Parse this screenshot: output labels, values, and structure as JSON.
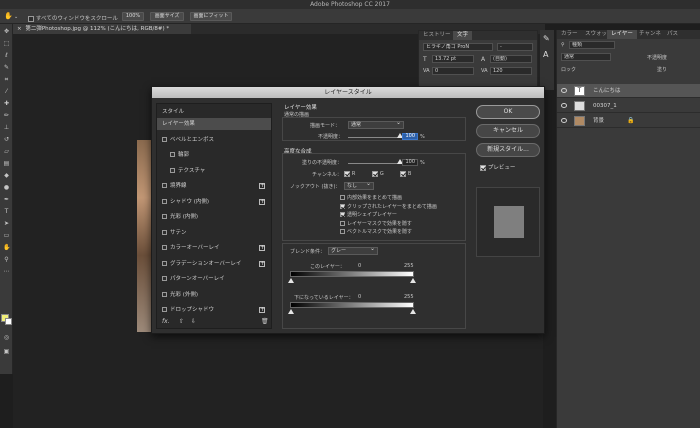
{
  "app_title": "Adobe Photoshop CC 2017",
  "options_bar": {
    "scroll_all_label": "すべてのウィンドウをスクロール",
    "zoom_100": "100%",
    "fit_screen": "画面サイズ",
    "fill_screen": "画面にフィット"
  },
  "document_tab": "第二弾Photoshop.jpg @ 112% (こんにちは, RGB/8#) *",
  "char_panel": {
    "tabs": [
      "ヒストリー",
      "文字"
    ],
    "active_tab": "文字",
    "font_family": "ヒラギノ角ゴ ProN",
    "font_style": "-",
    "font_size": "13.72 pt",
    "leading": "(自動)",
    "kerning": "0",
    "tracking": "120"
  },
  "layers_panel": {
    "tabs": [
      "カラー",
      "スウォッ",
      "レイヤー",
      "チャンネ",
      "パス"
    ],
    "active_tab": "レイヤー",
    "filter_kind": "種類",
    "blend_mode": "通常",
    "opacity_label": "不透明度",
    "lock_label": "ロック",
    "fill_label": "塗り",
    "layers": [
      {
        "name": "こんにちは",
        "type": "text",
        "selected": true
      },
      {
        "name": "00307_1",
        "type": "image",
        "selected": false
      },
      {
        "name": "背景",
        "type": "background",
        "selected": false
      }
    ]
  },
  "dialog": {
    "title": "レイヤースタイル",
    "styles_header": "スタイル",
    "styles": [
      {
        "label": "レイヤー効果",
        "selected": true,
        "checkbox": false,
        "plus": false,
        "indent": false
      },
      {
        "label": "ベベルとエンボス",
        "checkbox": true,
        "plus": false,
        "indent": false
      },
      {
        "label": "輪郭",
        "checkbox": true,
        "plus": false,
        "indent": true
      },
      {
        "label": "テクスチャ",
        "checkbox": true,
        "plus": false,
        "indent": true
      },
      {
        "label": "境界線",
        "checkbox": true,
        "plus": true,
        "indent": false
      },
      {
        "label": "シャドウ (内側)",
        "checkbox": true,
        "plus": true,
        "indent": false
      },
      {
        "label": "光彩 (内側)",
        "checkbox": true,
        "plus": false,
        "indent": false
      },
      {
        "label": "サテン",
        "checkbox": true,
        "plus": false,
        "indent": false
      },
      {
        "label": "カラーオーバーレイ",
        "checkbox": true,
        "plus": true,
        "indent": false
      },
      {
        "label": "グラデーションオーバーレイ",
        "checkbox": true,
        "plus": true,
        "indent": false
      },
      {
        "label": "パターンオーバーレイ",
        "checkbox": true,
        "plus": false,
        "indent": false
      },
      {
        "label": "光彩 (外側)",
        "checkbox": true,
        "plus": false,
        "indent": false
      },
      {
        "label": "ドロップシャドウ",
        "checkbox": true,
        "plus": true,
        "indent": false
      }
    ],
    "fx_label": "fx.",
    "general": {
      "section": "レイヤー効果",
      "subsection": "通常の描画",
      "blend_mode_label": "描画モード：",
      "blend_mode_value": "通常",
      "opacity_label": "不透明度：",
      "opacity_value": "100",
      "opacity_unit": "%",
      "opacity_level": 1.0
    },
    "advanced": {
      "section": "高度な合成",
      "fill_opacity_label": "塗りの不透明度：",
      "fill_opacity_value": "100",
      "fill_opacity_unit": "%",
      "fill_opacity_level": 1.0,
      "channels_label": "チャンネル：",
      "channels": [
        "R",
        "G",
        "B"
      ],
      "knockout_label": "ノックアウト (抜き)：",
      "knockout_value": "なし",
      "options": [
        {
          "label": "内部効果をまとめて描画",
          "checked": false
        },
        {
          "label": "クリップされたレイヤーをまとめて描画",
          "checked": true
        },
        {
          "label": "透明シェイプレイヤー",
          "checked": true
        },
        {
          "label": "レイヤーマスクで効果を隠す",
          "checked": false
        },
        {
          "label": "ベクトルマスクで効果を隠す",
          "checked": false
        }
      ]
    },
    "blend_if": {
      "label": "ブレンド条件：",
      "value": "グレー",
      "this_layer_label": "このレイヤー：",
      "this_layer_min": "0",
      "this_layer_max": "255",
      "underlying_label": "下になっているレイヤー：",
      "underlying_min": "0",
      "underlying_max": "255"
    },
    "buttons": {
      "ok": "OK",
      "cancel": "キャンセル",
      "new_style": "新規スタイル..."
    },
    "preview_label": "プレビュー",
    "preview_checked": true
  }
}
